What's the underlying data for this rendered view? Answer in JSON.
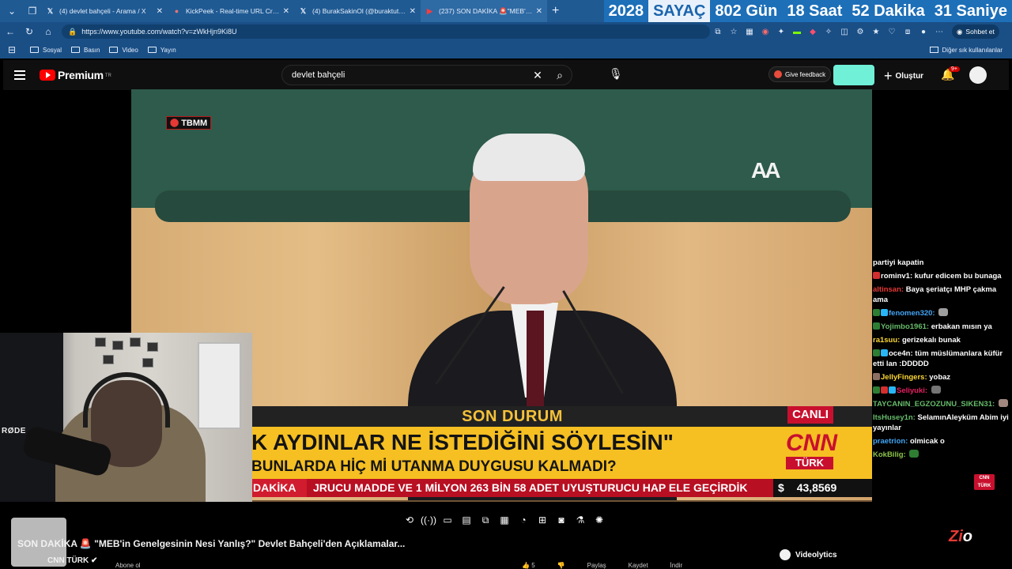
{
  "browser": {
    "tabs": [
      {
        "icon": "x-icon",
        "label": "(4) devlet bahçeli - Arama / X"
      },
      {
        "icon": "kickpeek-icon",
        "label": "KickPeek - Real-time URL Crawler"
      },
      {
        "icon": "x-icon",
        "label": "(4) BurakSakinOl (@buraktut_) / X"
      },
      {
        "icon": "youtube-icon",
        "label": "(237) SON DAKİKA 🚨\"MEB'in Gen"
      }
    ],
    "counter": {
      "year": "2028",
      "label": "SAYAÇ",
      "days": "802 Gün",
      "hours": "18 Saat",
      "minutes": "52 Dakika",
      "seconds": "31 Saniye"
    },
    "url": "https://www.youtube.com/watch?v=zWkHjn9Ki8U",
    "copilot_label": "Sohbet et",
    "bookmarks": [
      "Sosyal",
      "Basın",
      "Video",
      "Yayın"
    ],
    "bookmarks_right": "Diğer sık kullanılanlar"
  },
  "youtube": {
    "brand": "Premium",
    "region": "TR",
    "search_value": "devlet bahçeli",
    "feedback_label": "Give feedback",
    "create_label": "Oluştur",
    "notification_count": "9+"
  },
  "video": {
    "location_badge": "TBMM",
    "broadcaster_logo": "AA",
    "lower_third": {
      "title": "SON DURUM",
      "live": "CANLI",
      "headline": "K AYDINLAR NE İSTEDİĞİNİ SÖYLESİN\"",
      "subheadline": "BUNLARDA HİÇ Mİ UTANMA DUYGUSU KALMADI?",
      "ticker_label": "DAKİKA",
      "ticker_text": "JRUCU MADDE VE 1 MİLYON 263 BİN 58 ADET UYUŞTURUCU HAP ELE GEÇİRDİK",
      "currency_symbol": "$",
      "currency_value": "43,8569",
      "channel_logo_top": "CNN",
      "channel_logo_bottom": "TÜRK"
    },
    "webcam_brand": "RØDE"
  },
  "chat": [
    {
      "user": "",
      "text": "partiyi kapatin",
      "color": "#ffffff",
      "badges": []
    },
    {
      "user": "rominv1:",
      "text": "kufur edicem bu bunaga",
      "color": "#ffffff",
      "badges": [
        "#d32f2f"
      ]
    },
    {
      "user": "altinsan:",
      "text": "Baya şeriatçı MHP çakma ama",
      "color": "#e53935",
      "badges": []
    },
    {
      "user": "fenomen320:",
      "text": "",
      "color": "#42a5f5",
      "badges": [
        "#2e7d32",
        "#29b6f6"
      ],
      "emote": "#9e9e9e"
    },
    {
      "user": "Yojimbo1961:",
      "text": "erbakan mısın ya",
      "color": "#66bb6a",
      "badges": [
        "#2e7d32"
      ]
    },
    {
      "user": "ra1suu:",
      "text": "gerizekalı bunak",
      "color": "#fdd835",
      "badges": []
    },
    {
      "user": "oce4n:",
      "text": "tüm müslümanlara küfür etti lan :DDDDD",
      "color": "#ffffff",
      "badges": [
        "#2e7d32",
        "#29b6f6"
      ]
    },
    {
      "user": "JellyFingers:",
      "text": "yobaz",
      "color": "#fdd835",
      "badges": [
        "#8d6e63"
      ]
    },
    {
      "user": "Seliyuki:",
      "text": "",
      "color": "#e91e63",
      "badges": [
        "#2e7d32",
        "#d32f2f",
        "#29b6f6"
      ],
      "emote": "#757575"
    },
    {
      "user": "TAYCANIN_EGZOZUNU_SIKEN31:",
      "text": "",
      "color": "#66bb6a",
      "badges": [],
      "emote": "#a1887f"
    },
    {
      "user": "ItsHusey1n:",
      "text": "SelamınAleyküm Abim iyi yayınlar",
      "color": "#66bb6a",
      "badges": []
    },
    {
      "user": "praetrion:",
      "text": "olmicak o",
      "color": "#42a5f5",
      "badges": []
    },
    {
      "user": "KokBilig:",
      "text": "",
      "color": "#8bc34a",
      "badges": [],
      "emote": "#2e7d32"
    }
  ],
  "player": {
    "title": "SON DAKİKA 🚨 \"MEB'in Genelgesinin Nesi Yanlış?\" Devlet Bahçeli'den Açıklamalar...",
    "channel": "CNN TÜRK",
    "subscribe_label": "Abone ol",
    "like_count": "5",
    "share_label": "Paylaş",
    "save_label": "Kaydet",
    "download_label": "İndir",
    "videolytics_label": "Videolytics",
    "overlay_logo": "Zio"
  }
}
